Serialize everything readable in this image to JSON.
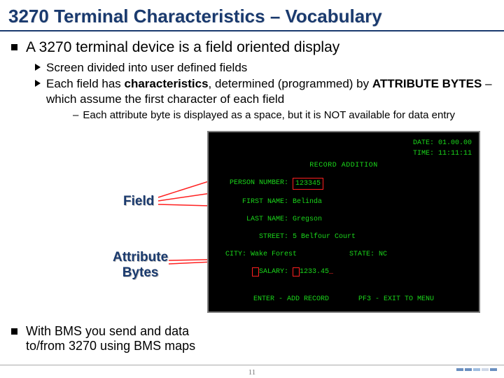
{
  "title": "3270 Terminal Characteristics – Vocabulary",
  "b1": "A 3270 terminal device is a field oriented display",
  "b2a": "Screen divided into user defined fields",
  "b2b_pre": "Each field has ",
  "b2b_bold": "characteristics",
  "b2b_mid": ", determined (programmed) by ",
  "b2b_attr": "ATTRIBUTE BYTES",
  "b2b_post": " – which assume the first character of each field",
  "b3": "Each attribute byte is displayed as a space, but it is NOT available for data entry",
  "label_field": "Field",
  "label_attr1": "Attribute",
  "label_attr2": "Bytes",
  "term": {
    "date_lbl": "DATE:",
    "date_val": "01.00.00",
    "time_lbl": "TIME:",
    "time_val": "11:11:11",
    "app_title": "RECORD ADDITION",
    "pn_lbl": "PERSON NUMBER:",
    "pn_val": "123345",
    "fn_lbl": "FIRST NAME:",
    "fn_val": "Belinda",
    "ln_lbl": "LAST NAME:",
    "ln_val": "Gregson",
    "st_lbl": "STREET:",
    "st_val": "5 Belfour Court",
    "ci_lbl": "CITY:",
    "ci_val": "Wake Forest",
    "sta_lbl": "STATE:",
    "sta_val": "NC",
    "sal_lbl": "SALARY:",
    "sal_val": "1233.45",
    "footer": "ENTER - ADD RECORD       PF3 - EXIT TO MENU"
  },
  "bms": "With BMS you send and data to/from 3270 using BMS maps",
  "page": "11"
}
